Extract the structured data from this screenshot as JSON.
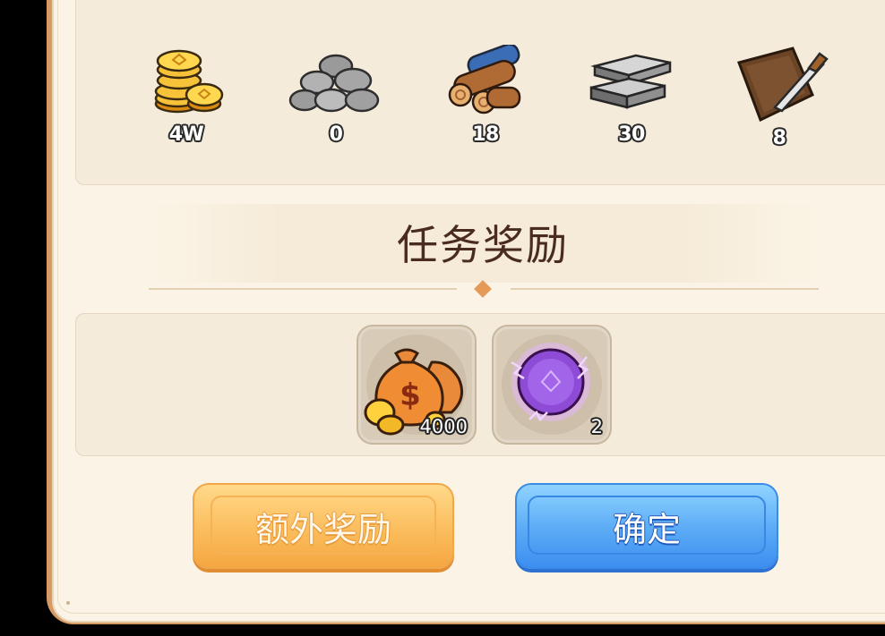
{
  "resources": [
    {
      "icon": "gold-coins-icon",
      "count": "4W"
    },
    {
      "icon": "stone-pile-icon",
      "count": "0"
    },
    {
      "icon": "wood-logs-icon",
      "count": "18"
    },
    {
      "icon": "iron-ingot-icon",
      "count": "30"
    },
    {
      "icon": "leather-hide-icon",
      "count": "8"
    }
  ],
  "reward_title": "任务奖励",
  "rewards": [
    {
      "icon": "money-bag-icon",
      "count": "4000"
    },
    {
      "icon": "purple-orb-icon",
      "count": "2"
    }
  ],
  "buttons": {
    "extra_label": "额外奖励",
    "confirm_label": "确定"
  },
  "colors": {
    "frame": "#d89a63",
    "panel": "#fbf4e6",
    "title_text": "#4a2b1f",
    "extra_button": "#fbbd5d",
    "confirm_button": "#5aaaf5"
  }
}
